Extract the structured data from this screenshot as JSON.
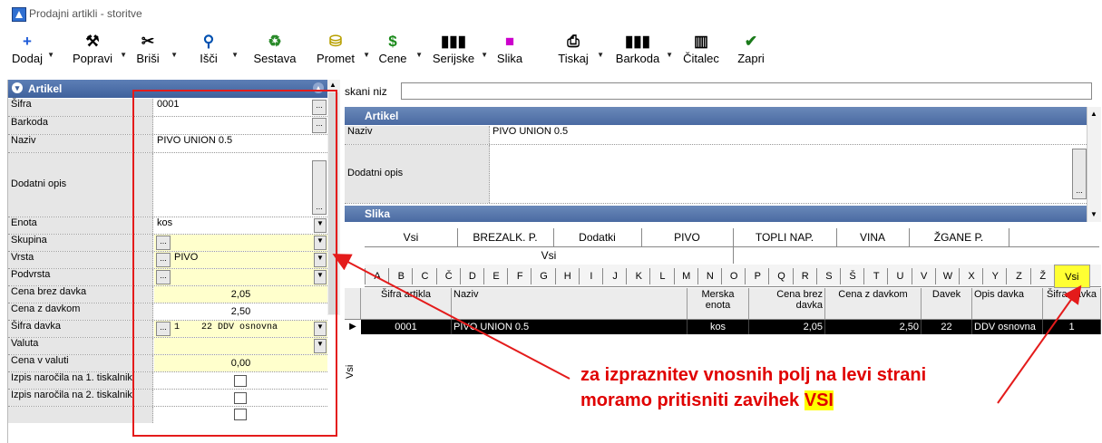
{
  "window": {
    "title": "Prodajni artikli - storitve"
  },
  "toolbar": {
    "items": [
      {
        "label": "Dodaj",
        "icon": "plus-icon",
        "glyph": "+",
        "color": "#1e5bd8"
      },
      {
        "label": "Popravi",
        "icon": "hammer-icon",
        "glyph": "⚒",
        "color": "#000000"
      },
      {
        "label": "Briši",
        "icon": "scissors-icon",
        "glyph": "✂",
        "color": "#000000"
      },
      {
        "label": "Išči",
        "icon": "search-icon",
        "glyph": "⚲",
        "color": "#0050b0"
      },
      {
        "label": "Sestava",
        "icon": "recycle-icon",
        "glyph": "♻",
        "color": "#2a8a2a"
      },
      {
        "label": "Promet",
        "icon": "coins-icon",
        "glyph": "⛁",
        "color": "#b8a000"
      },
      {
        "label": "Cene",
        "icon": "dollar-icon",
        "glyph": "$",
        "color": "#1a8a1a"
      },
      {
        "label": "Serijske",
        "icon": "barcode-icon",
        "glyph": "▮▮▮",
        "color": "#000000"
      },
      {
        "label": "Slika",
        "icon": "image-icon",
        "glyph": "■",
        "color": "#cc00cc"
      },
      {
        "label": "Tiskaj",
        "icon": "printer-icon",
        "glyph": "⎙",
        "color": "#000000"
      },
      {
        "label": "Barkoda",
        "icon": "barcode-icon",
        "glyph": "▮▮▮",
        "color": "#000000"
      },
      {
        "label": "Čitalec",
        "icon": "scanner-icon",
        "glyph": "▥",
        "color": "#000000"
      },
      {
        "label": "Zapri",
        "icon": "checkmark-icon",
        "glyph": "✔",
        "color": "#1a7a1a"
      }
    ]
  },
  "left_panel": {
    "title": "Artikel",
    "fields": {
      "sifra": {
        "label": "Šifra",
        "value": "0001"
      },
      "barkoda": {
        "label": "Barkoda",
        "value": ""
      },
      "naziv": {
        "label": "Naziv",
        "value": "PIVO UNION 0.5"
      },
      "dodatni_opis": {
        "label": "Dodatni opis",
        "value": ""
      },
      "enota": {
        "label": "Enota",
        "value": "kos"
      },
      "skupina": {
        "label": "Skupina",
        "value": ""
      },
      "vrsta": {
        "label": "Vrsta",
        "value": "PIVO"
      },
      "podvrsta": {
        "label": "Podvrsta",
        "value": ""
      },
      "cena_brez_davka": {
        "label": "Cena brez davka",
        "value": "2,05"
      },
      "cena_z_davkom": {
        "label": "Cena z davkom",
        "value": "2,50"
      },
      "sifra_davka": {
        "label": "Šifra davka",
        "value": "1    22 DDV osnovna"
      },
      "valuta": {
        "label": "Valuta",
        "value": ""
      },
      "cena_v_valuti": {
        "label": "Cena v valuti",
        "value": "0,00"
      },
      "izpis1": {
        "label": "Izpis naročila na 1. tiskalnik"
      },
      "izpis2": {
        "label": "Izpis naročila na 2. tiskalnik"
      }
    }
  },
  "search": {
    "label": "skani niz",
    "value": ""
  },
  "right_panel": {
    "section_artikel": "Artikel",
    "naziv_label": "Naziv",
    "naziv_value": "PIVO UNION 0.5",
    "dodatni_opis_label": "Dodatni opis",
    "section_slika": "Slika"
  },
  "group_tabs": [
    "Vsi",
    "BREZALK. P.",
    "Dodatki",
    "PIVO",
    "TOPLI NAP.",
    "VINA",
    "ŽGANE P."
  ],
  "subgroup_tab": "Vsi",
  "letter_tabs": [
    "A",
    "B",
    "C",
    "Č",
    "D",
    "E",
    "F",
    "G",
    "H",
    "I",
    "J",
    "K",
    "L",
    "M",
    "N",
    "O",
    "P",
    "Q",
    "R",
    "S",
    "Š",
    "T",
    "U",
    "V",
    "W",
    "X",
    "Y",
    "Z",
    "Ž",
    "Vsi"
  ],
  "active_letter_tab": "Vsi",
  "side_label": "Vsi",
  "grid": {
    "headers": [
      "Šifra artikla",
      "Naziv",
      "Merska enota",
      "Cena brez davka",
      "Cena z davkom",
      "Davek",
      "Opis davka",
      "Šifra davka"
    ],
    "rows": [
      [
        "0001",
        "PIVO UNION 0.5",
        "kos",
        "2,05",
        "2,50",
        "22",
        "DDV osnovna :",
        "1"
      ]
    ]
  },
  "annotation": {
    "line1": "za izpraznitev vnosnih polj na levi strani",
    "line2": "moramo pritisniti zavihek",
    "highlight": "VSI",
    "color": "#e00000"
  }
}
